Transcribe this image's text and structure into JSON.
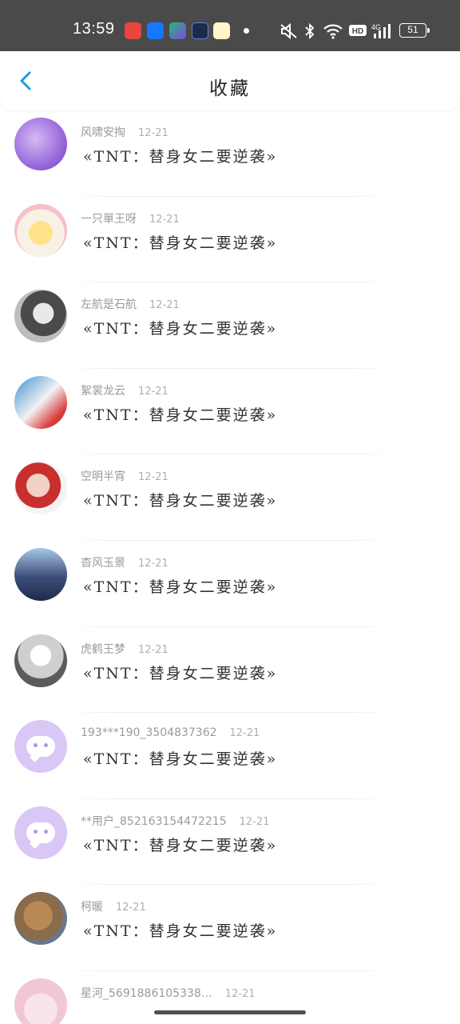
{
  "status_bar": {
    "time": "13:59",
    "battery": "51",
    "app_icons": [
      "weibo-like-icon",
      "alipay-icon",
      "iqiyi-icon",
      "ai-app-icon",
      "meituan-icon"
    ],
    "system_icons": [
      "mute-icon",
      "bluetooth-icon",
      "wifi-icon",
      "hd-icon",
      "signal-4g-icon",
      "battery-icon"
    ]
  },
  "header": {
    "title": "收藏",
    "back_icon": "chevron-left-icon",
    "accent_color": "#1d9be6"
  },
  "items": [
    {
      "name": "风啸安掏",
      "date": "12-21",
      "book": "«TNT：替身女二要逆袭»"
    },
    {
      "name": "一只單王呀",
      "date": "12-21",
      "book": "«TNT：替身女二要逆袭»"
    },
    {
      "name": "左航是石航",
      "date": "12-21",
      "book": "«TNT：替身女二要逆袭»"
    },
    {
      "name": "絮裳龙云",
      "date": "12-21",
      "book": "«TNT：替身女二要逆袭»"
    },
    {
      "name": "空明半宵",
      "date": "12-21",
      "book": "«TNT：替身女二要逆袭»"
    },
    {
      "name": "杳风玉景",
      "date": "12-21",
      "book": "«TNT：替身女二要逆袭»"
    },
    {
      "name": "虎鹤王梦",
      "date": "12-21",
      "book": "«TNT：替身女二要逆袭»"
    },
    {
      "name": "193***190_3504837362",
      "date": "12-21",
      "book": "«TNT：替身女二要逆袭»"
    },
    {
      "name": "**用户_852163154472215",
      "date": "12-21",
      "book": "«TNT：替身女二要逆袭»"
    },
    {
      "name": "柯暖",
      "date": "12-21",
      "book": "«TNT：替身女二要逆袭»"
    },
    {
      "name": "星河_5691886105338…",
      "date": "12-21",
      "book": ""
    }
  ]
}
